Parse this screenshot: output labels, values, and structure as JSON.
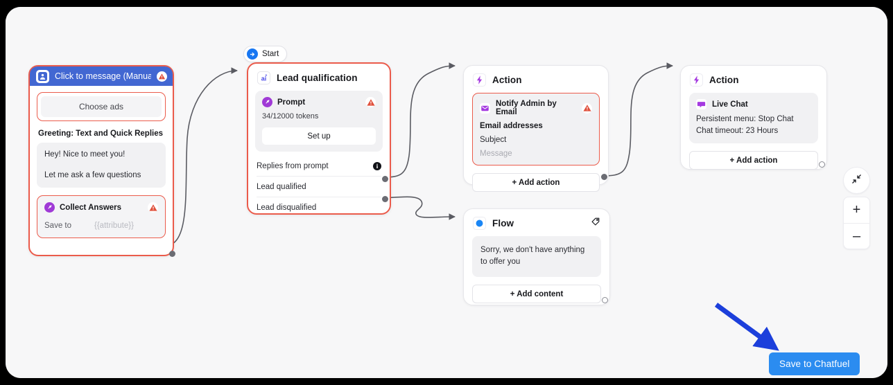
{
  "canvas": {
    "background": "#f7f7f8",
    "accent_selected": "#eb5b4b",
    "accent_blue": "#2b8cf0",
    "fb_blue": "#4267d2",
    "annotation_arrow_color": "#1c3fdb"
  },
  "start_pill": {
    "label": "Start",
    "icon": "arrow-right-circle-icon"
  },
  "entry_node": {
    "title": "Click to message (Manual ...",
    "icon": "click-to-message-icon",
    "warning_icon": "warning-triangle-icon",
    "choose_ads_label": "Choose ads",
    "greeting_label": "Greeting: Text and Quick Replies",
    "bubbles": [
      "Hey! Nice to meet you!",
      "Let me ask a few questions"
    ],
    "collect": {
      "title": "Collect Answers",
      "icon": "collect-answers-icon",
      "warning_icon": "warning-triangle-icon",
      "save_to_label": "Save to",
      "save_to_value": "{{attribute}}"
    }
  },
  "lead_node": {
    "title": "Lead qualification",
    "icon": "ai-icon",
    "prompt": {
      "title": "Prompt",
      "icon": "prompt-icon",
      "warning_icon": "warning-triangle-icon",
      "tokens": "34/12000 tokens",
      "setup_label": "Set up"
    },
    "outputs": [
      {
        "label": "Replies from prompt",
        "port": "info"
      },
      {
        "label": "Lead qualified",
        "port": "dot"
      },
      {
        "label": "Lead disqualified",
        "port": "dot"
      }
    ]
  },
  "action_email_node": {
    "title": "Action",
    "icon": "action-bolt-icon",
    "card": {
      "title": "Notify Admin by Email",
      "icon": "email-icon",
      "warning_icon": "warning-triangle-icon",
      "fields": [
        {
          "text": "Email addresses",
          "style": "bold"
        },
        {
          "text": "Subject",
          "style": "normal"
        },
        {
          "text": "Message",
          "style": "muted"
        }
      ]
    },
    "add_label": "+ Add action"
  },
  "action_chat_node": {
    "title": "Action",
    "icon": "action-bolt-icon",
    "card": {
      "title": "Live Chat",
      "icon": "live-chat-icon",
      "lines": [
        "Persistent menu: Stop Chat",
        "Chat timeout: 23 Hours"
      ]
    },
    "add_label": "+ Add action"
  },
  "flow_node": {
    "title": "Flow",
    "icon": "flow-dot-icon",
    "tag_icon": "tag-icon",
    "message": "Sorry, we don't have anything to offer you",
    "add_label": "+ Add content"
  },
  "controls": {
    "fit_label": "",
    "fit_icon": "collapse-arrows-icon",
    "zoom_in": "+",
    "zoom_out": "–"
  },
  "save_button": {
    "label": "Save to Chatfuel"
  }
}
